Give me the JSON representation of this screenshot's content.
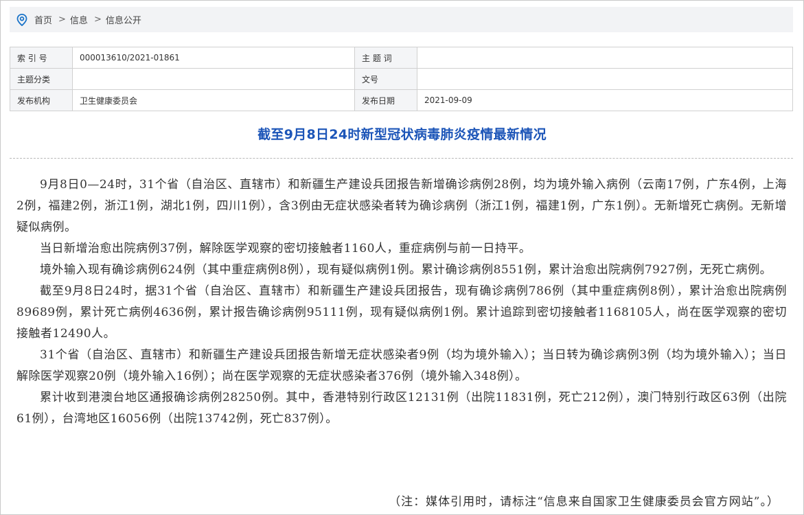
{
  "breadcrumb": {
    "home": "首页",
    "sep1": ">",
    "level1": "信息",
    "sep2": ">",
    "level2": "信息公开"
  },
  "meta": {
    "index_label": "索 引 号",
    "index_value": "000013610/2021-01861",
    "keyword_label": "主 题 词",
    "keyword_value": "",
    "category_label": "主题分类",
    "category_value": "",
    "docno_label": "文号",
    "docno_value": "",
    "publisher_label": "发布机构",
    "publisher_value": "卫生健康委员会",
    "date_label": "发布日期",
    "date_value": "2021-09-09"
  },
  "article": {
    "title": "截至9月8日24时新型冠状病毒肺炎疫情最新情况",
    "paragraphs": [
      "9月8日0—24时，31个省（自治区、直辖市）和新疆生产建设兵团报告新增确诊病例28例，均为境外输入病例（云南17例，广东4例，上海2例，福建2例，浙江1例，湖北1例，四川1例），含3例由无症状感染者转为确诊病例（浙江1例，福建1例，广东1例）。无新增死亡病例。无新增疑似病例。",
      "当日新增治愈出院病例37例，解除医学观察的密切接触者1160人，重症病例与前一日持平。",
      "境外输入现有确诊病例624例（其中重症病例8例），现有疑似病例1例。累计确诊病例8551例，累计治愈出院病例7927例，无死亡病例。",
      "截至9月8日24时，据31个省（自治区、直辖市）和新疆生产建设兵团报告，现有确诊病例786例（其中重症病例8例），累计治愈出院病例89689例，累计死亡病例4636例，累计报告确诊病例95111例，现有疑似病例1例。累计追踪到密切接触者1168105人，尚在医学观察的密切接触者12490人。",
      "31个省（自治区、直辖市）和新疆生产建设兵团报告新增无症状感染者9例（均为境外输入）；当日转为确诊病例3例（均为境外输入）；当日解除医学观察20例（境外输入16例）；尚在医学观察的无症状感染者376例（境外输入348例）。",
      "累计收到港澳台地区通报确诊病例28250例。其中，香港特别行政区12131例（出院11831例，死亡212例），澳门特别行政区63例（出院61例），台湾地区16056例（出院13742例，死亡837例）。"
    ],
    "note": "（注：媒体引用时，请标注“信息来自国家卫生健康委员会官方网站”。）"
  },
  "colors": {
    "title": "#1c55b8",
    "pin_icon": "#1a73c8",
    "breadcrumb_bg": "#f2f3f5"
  },
  "icons": {
    "location": "location-pin-icon"
  }
}
